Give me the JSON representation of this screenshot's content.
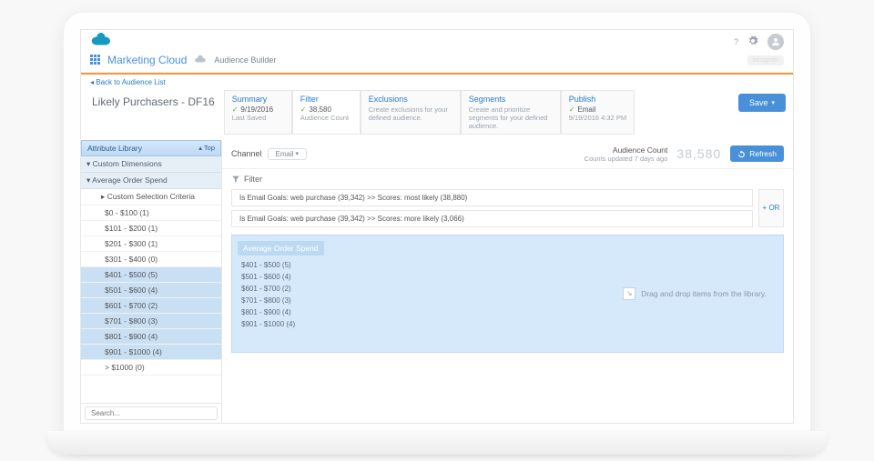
{
  "top": {
    "brand_title": "Marketing Cloud",
    "subapp": "Audience Builder",
    "back_link": "Back to Audience List",
    "user_badge": "Incognito"
  },
  "header": {
    "title": "Likely Purchasers - DF16",
    "tabs": {
      "summary": {
        "label": "Summary",
        "line1": "9/19/2016",
        "line2": "Last Saved"
      },
      "filter": {
        "label": "Filter",
        "line1": "38,580",
        "line2": "Audience Count"
      },
      "exclusions": {
        "label": "Exclusions",
        "line2": "Create exclusions for your defined audience."
      },
      "segments": {
        "label": "Segments",
        "line2": "Create and prioritize segments for your defined audience."
      },
      "publish": {
        "label": "Publish",
        "line1": "Email",
        "line2": "9/19/2016 4:32 PM"
      }
    },
    "save_label": "Save"
  },
  "sidebar": {
    "library_title": "Attribute Library",
    "top_label": "Top",
    "groups": {
      "custom_dimensions": "Custom Dimensions",
      "avg_order_spend": "Average Order Spend",
      "custom_sel_crit": "Custom Selection Criteria"
    },
    "ranges": [
      {
        "label": "$0 - $100 (1)",
        "selected": false
      },
      {
        "label": "$101 - $200 (1)",
        "selected": false
      },
      {
        "label": "$201 - $300 (1)",
        "selected": false
      },
      {
        "label": "$301 - $400 (0)",
        "selected": false
      },
      {
        "label": "$401 - $500 (5)",
        "selected": true
      },
      {
        "label": "$501 - $600 (4)",
        "selected": true
      },
      {
        "label": "$601 - $700 (2)",
        "selected": true
      },
      {
        "label": "$701 - $800 (3)",
        "selected": true
      },
      {
        "label": "$801 - $900 (4)",
        "selected": true
      },
      {
        "label": "$901 - $1000 (4)",
        "selected": true
      },
      {
        "label": "> $1000 (0)",
        "selected": false
      }
    ],
    "search_placeholder": "Search..."
  },
  "channel": {
    "label": "Channel",
    "value": "Email",
    "audience_count_label": "Audience Count",
    "audience_count_sub": "Counts updated 7 days ago",
    "audience_count_value": "38,580",
    "refresh_label": "Refresh"
  },
  "filter": {
    "section_title": "Filter",
    "rules": [
      "Is  Email Goals: web purchase (39,342) >> Scores: most likely (38,880)",
      "Is  Email Goals: web purchase (39,342) >> Scores: more likely (3,066)"
    ],
    "or_label": "+ OR",
    "drop": {
      "title": "Average Order Spend",
      "items": [
        "$401 - $500 (5)",
        "$501 - $600 (4)",
        "$601 - $700 (2)",
        "$701 - $800 (3)",
        "$801 - $900 (4)",
        "$901 - $1000 (4)"
      ],
      "hint": "Drag and drop items from the library."
    }
  }
}
